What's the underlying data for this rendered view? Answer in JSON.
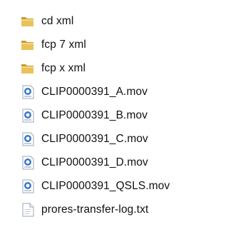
{
  "files": [
    {
      "name": "cd xml",
      "icon": "folder-icon"
    },
    {
      "name": "fcp 7 xml",
      "icon": "folder-icon"
    },
    {
      "name": "fcp x xml",
      "icon": "folder-icon"
    },
    {
      "name": "CLIP0000391_A.mov",
      "icon": "quicktime-movie-icon"
    },
    {
      "name": "CLIP0000391_B.mov",
      "icon": "quicktime-movie-icon"
    },
    {
      "name": "CLIP0000391_C.mov",
      "icon": "quicktime-movie-icon"
    },
    {
      "name": "CLIP0000391_D.mov",
      "icon": "quicktime-movie-icon"
    },
    {
      "name": "CLIP0000391_QSLS.mov",
      "icon": "quicktime-movie-icon"
    },
    {
      "name": "prores-transfer-log.txt",
      "icon": "text-document-icon"
    }
  ],
  "colors": {
    "folder": "#e9c25a",
    "folder_dark": "#c99a2e",
    "movie_blue": "#3a78c8",
    "document_border": "#9aa7b8"
  }
}
